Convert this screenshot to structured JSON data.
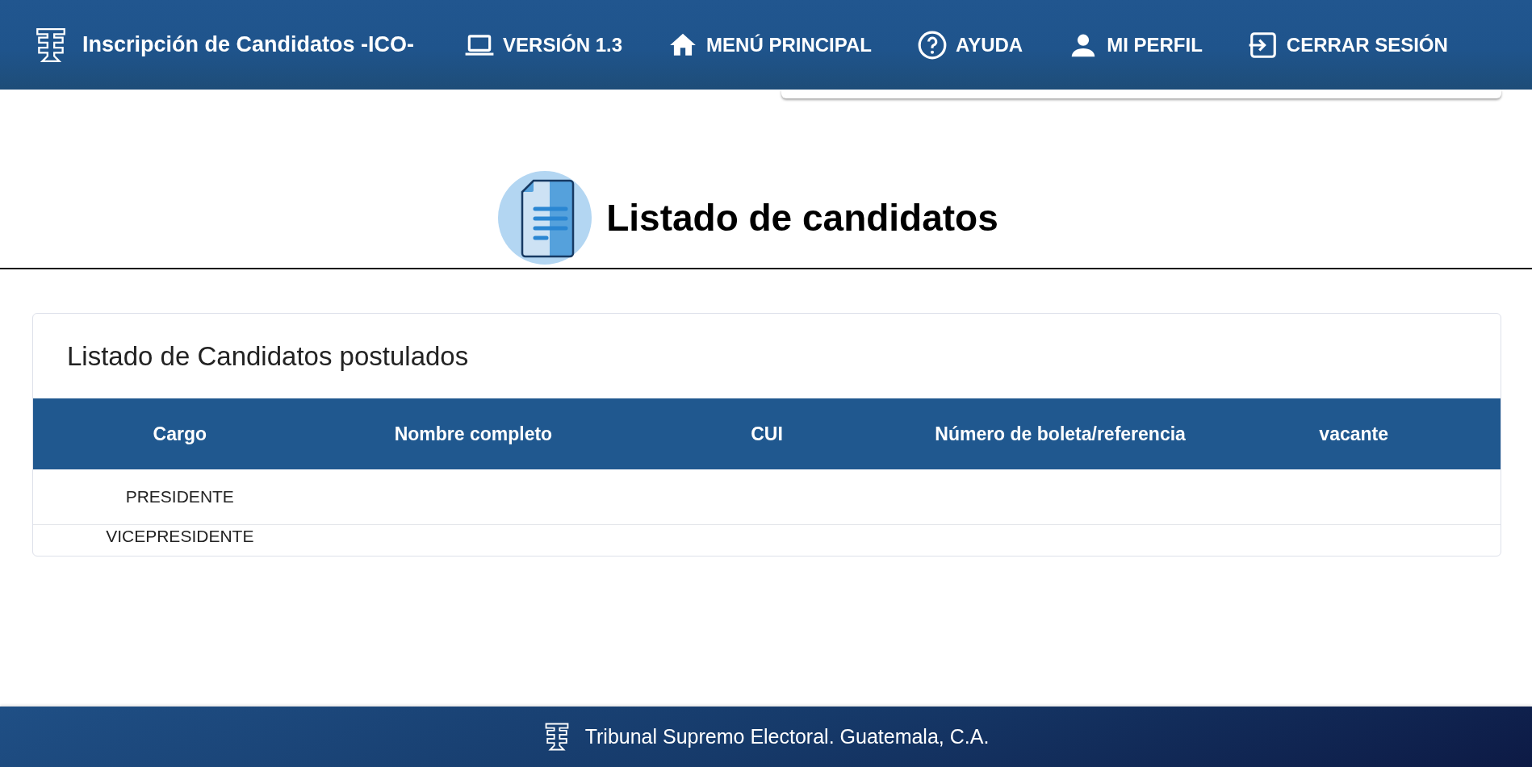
{
  "header": {
    "title": "Inscripción de Candidatos -ICO-",
    "nav": [
      {
        "label": "VERSIÓN 1.3"
      },
      {
        "label": "MENÚ PRINCIPAL"
      },
      {
        "label": "AYUDA"
      },
      {
        "label": "MI PERFIL"
      },
      {
        "label": "CERRAR SESIÓN"
      }
    ]
  },
  "page_title": "Listado de candidatos",
  "card": {
    "title": "Listado de Candidatos postulados",
    "table": {
      "columns": [
        "Cargo",
        "Nombre completo",
        "CUI",
        "Número de boleta/referencia",
        "vacante"
      ],
      "rows": [
        {
          "cargo": "PRESIDENTE"
        },
        {
          "cargo": "VICEPRESIDENTE"
        }
      ]
    }
  },
  "footer": {
    "text": "Tribunal Supremo Electoral. Guatemala, C.A."
  }
}
